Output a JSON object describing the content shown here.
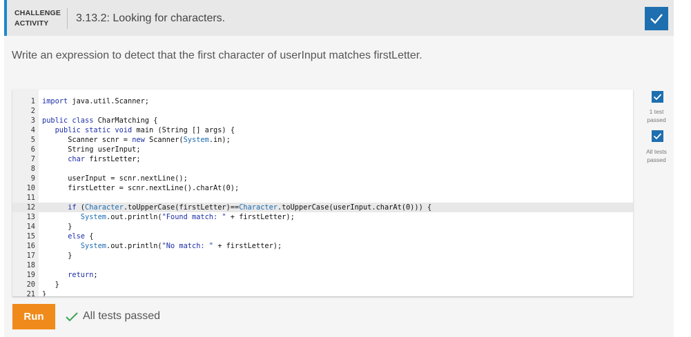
{
  "header": {
    "tag_line1": "CHALLENGE",
    "tag_line2": "ACTIVITY",
    "title": "3.13.2: Looking for characters.",
    "badge_icon": "check-icon"
  },
  "instructions": "Write an expression to detect that the first character of userInput matches firstLetter.",
  "editor": {
    "active_line": 12,
    "lines": [
      {
        "n": "1",
        "text": "import java.util.Scanner;"
      },
      {
        "n": "2",
        "text": ""
      },
      {
        "n": "3",
        "text": "public class CharMatching {"
      },
      {
        "n": "4",
        "text": "   public static void main (String [] args) {"
      },
      {
        "n": "5",
        "text": "      Scanner scnr = new Scanner(System.in);"
      },
      {
        "n": "6",
        "text": "      String userInput;"
      },
      {
        "n": "7",
        "text": "      char firstLetter;"
      },
      {
        "n": "8",
        "text": ""
      },
      {
        "n": "9",
        "text": "      userInput = scnr.nextLine();"
      },
      {
        "n": "10",
        "text": "      firstLetter = scnr.nextLine().charAt(0);"
      },
      {
        "n": "11",
        "text": ""
      },
      {
        "n": "12",
        "text": "      if (Character.toUpperCase(firstLetter)==Character.toUpperCase(userInput.charAt(0))) {"
      },
      {
        "n": "13",
        "text": "         System.out.println(\"Found match: \" + firstLetter);"
      },
      {
        "n": "14",
        "text": "      }"
      },
      {
        "n": "15",
        "text": "      else {"
      },
      {
        "n": "16",
        "text": "         System.out.println(\"No match: \" + firstLetter);"
      },
      {
        "n": "17",
        "text": "      }"
      },
      {
        "n": "18",
        "text": ""
      },
      {
        "n": "19",
        "text": "      return;"
      },
      {
        "n": "20",
        "text": "   }"
      },
      {
        "n": "21",
        "text": "}"
      }
    ]
  },
  "tests": [
    {
      "label_line1": "1 test",
      "label_line2": "passed"
    },
    {
      "label_line1": "All tests",
      "label_line2": "passed"
    }
  ],
  "run_label": "Run",
  "result_text": "All tests passed",
  "colors": {
    "accent": "#1e88c9",
    "badge": "#1e6fb0",
    "run": "#f08a1a",
    "pass": "#3aa356"
  }
}
